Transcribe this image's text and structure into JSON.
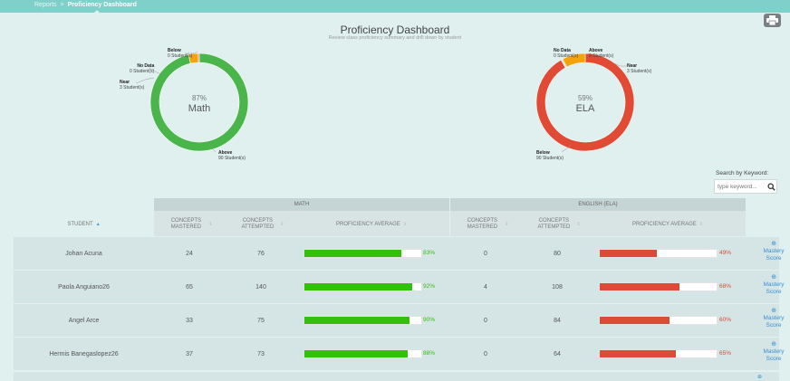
{
  "breadcrumb": {
    "parent": "Reports",
    "separator": ">",
    "current": "Proficiency Dashboard"
  },
  "header": {
    "title": "Proficiency Dashboard",
    "subtitle": "Review class proficiency summary and drill down by student"
  },
  "print_icon": "printer-icon",
  "charts": [
    {
      "subject": "Math",
      "percent_label": "87%",
      "segments": [
        {
          "name": "Above",
          "count_label": "90 Student(s)",
          "value": 90,
          "color": "#4ab54a"
        },
        {
          "name": "Near",
          "count_label": "3 Student(s)",
          "value": 3,
          "color": "#f5a30c"
        },
        {
          "name": "Below",
          "count_label": "0 Student(s)",
          "value": 0.3,
          "color": "#e14a34"
        },
        {
          "name": "No Data",
          "count_label": "0 Student(s)",
          "value": 0,
          "color": "#cccccc"
        }
      ]
    },
    {
      "subject": "ELA",
      "percent_label": "59%",
      "segments": [
        {
          "name": "Below",
          "count_label": "90 Student(s)",
          "value": 90,
          "color": "#e14a34"
        },
        {
          "name": "No Data",
          "count_label": "0 Student(s)",
          "value": 0.3,
          "color": "#cccccc"
        },
        {
          "name": "Above",
          "count_label": "0 Student(s)",
          "value": 0.3,
          "color": "#4ab54a"
        },
        {
          "name": "Near",
          "count_label": "3 Student(s)",
          "value": 7.5,
          "color": "#f5a30c"
        }
      ]
    }
  ],
  "search": {
    "label": "Search by Keyword:",
    "placeholder": "type keyword...",
    "value": ""
  },
  "table": {
    "group_math": "MATH",
    "group_ela": "ENGLISH (ELA)",
    "col_student": "STUDENT",
    "col_mastered": "CONCEPTS MASTERED",
    "col_attempted": "CONCEPTS ATTEMPTED",
    "col_average": "PROFICIENCY AVERAGE",
    "mastery_label": "Mastery Score",
    "math_color": "#33c00a",
    "ela_color": "#dc4a38",
    "rows": [
      {
        "student": "Johan Acuna",
        "math_mastered": "24",
        "math_attempted": "76",
        "math_pct": 83,
        "math_pct_label": "83%",
        "ela_mastered": "0",
        "ela_attempted": "80",
        "ela_pct": 49,
        "ela_pct_label": "49%"
      },
      {
        "student": "Paola Anguiano26",
        "math_mastered": "65",
        "math_attempted": "140",
        "math_pct": 92,
        "math_pct_label": "92%",
        "ela_mastered": "4",
        "ela_attempted": "108",
        "ela_pct": 68,
        "ela_pct_label": "68%"
      },
      {
        "student": "Angel Arce",
        "math_mastered": "33",
        "math_attempted": "75",
        "math_pct": 90,
        "math_pct_label": "90%",
        "ela_mastered": "0",
        "ela_attempted": "84",
        "ela_pct": 60,
        "ela_pct_label": "60%"
      },
      {
        "student": "Hermis Banegaslopez26",
        "math_mastered": "37",
        "math_attempted": "73",
        "math_pct": 88,
        "math_pct_label": "88%",
        "ela_mastered": "0",
        "ela_attempted": "64",
        "ela_pct": 65,
        "ela_pct_label": "65%"
      }
    ]
  }
}
